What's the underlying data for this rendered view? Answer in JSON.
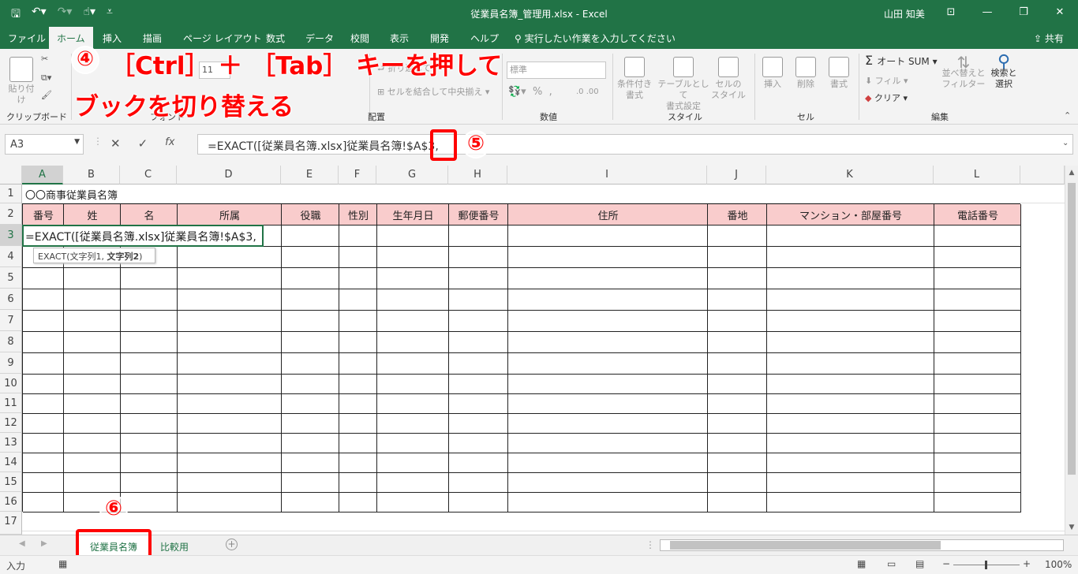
{
  "window": {
    "title": "従業員名簿_管理用.xlsx  -  Excel",
    "user": "山田 知美",
    "qat_icons": [
      "save-icon",
      "undo-icon",
      "redo-icon",
      "touch-mode-icon",
      "customize-icon"
    ]
  },
  "ribbon_tabs": [
    {
      "label": "ファイル",
      "active": false
    },
    {
      "label": "ホーム",
      "active": true
    },
    {
      "label": "挿入",
      "active": false
    },
    {
      "label": "描画",
      "active": false
    },
    {
      "label": "ページ レイアウト",
      "active": false
    },
    {
      "label": "数式",
      "active": false
    },
    {
      "label": "データ",
      "active": false
    },
    {
      "label": "校閲",
      "active": false
    },
    {
      "label": "表示",
      "active": false
    },
    {
      "label": "開発",
      "active": false
    },
    {
      "label": "ヘルプ",
      "active": false
    }
  ],
  "tell_me": "実行したい作業を入力してください",
  "share": "共有",
  "ribbon": {
    "paste": "貼り付け",
    "clipboard": "クリップボード",
    "font": "フォント",
    "font_size": "11",
    "wrap": "折り返して",
    "merge": "セルを結合して中央揃え",
    "alignment": "配置",
    "number_format": "標準",
    "number": "数値",
    "cond_format": "条件付き\n書式",
    "table_format": "テーブルとして\n書式設定",
    "cell_style": "セルの\nスタイル",
    "styles": "スタイル",
    "insert": "挿入",
    "delete": "削除",
    "format": "書式",
    "cells": "セル",
    "autosum": "オート SUM",
    "fill": "フィル",
    "clear": "クリア",
    "sort_filter": "並べ替えと\nフィルター",
    "find_select": "検索と\n選択",
    "editing": "編集"
  },
  "annotations": {
    "step4_num": "④",
    "step4_line1": "［Ctrl］ ＋ ［Tab］ キーを押して",
    "step4_line2": "ブックを切り替える",
    "step5_num": "⑤",
    "step6_num": "⑥"
  },
  "formula_bar": {
    "name_box": "A3",
    "formula": "=EXACT([従業員名簿.xlsx]従業員名簿!$A$3,",
    "fx": "fx"
  },
  "sheet": {
    "columns": [
      "A",
      "B",
      "C",
      "D",
      "E",
      "F",
      "G",
      "H",
      "I",
      "J",
      "K",
      "L"
    ],
    "rows": [
      "1",
      "2",
      "3",
      "4",
      "5",
      "6",
      "7",
      "8",
      "9",
      "10",
      "11",
      "12",
      "13",
      "14",
      "15",
      "16",
      "17"
    ],
    "a1": "〇〇商事従業員名簿",
    "headers": [
      "番号",
      "姓",
      "名",
      "所属",
      "役職",
      "性別",
      "生年月日",
      "郵便番号",
      "住所",
      "番地",
      "マンション・部屋番号",
      "電話番号"
    ],
    "a3_edit": "=EXACT([従業員名簿.xlsx]従業員名簿!$A$3,",
    "tooltip_fn": "EXACT(文字列1, ",
    "tooltip_arg": "文字列2",
    "tooltip_close": ")"
  },
  "sheet_tabs": [
    "従業員名簿",
    "比較用"
  ],
  "status": {
    "mode": "入力",
    "zoom": "100%"
  },
  "colors": {
    "excel_green": "#217346",
    "header_fill": "#f9cccc",
    "annotation": "#ff0000"
  }
}
